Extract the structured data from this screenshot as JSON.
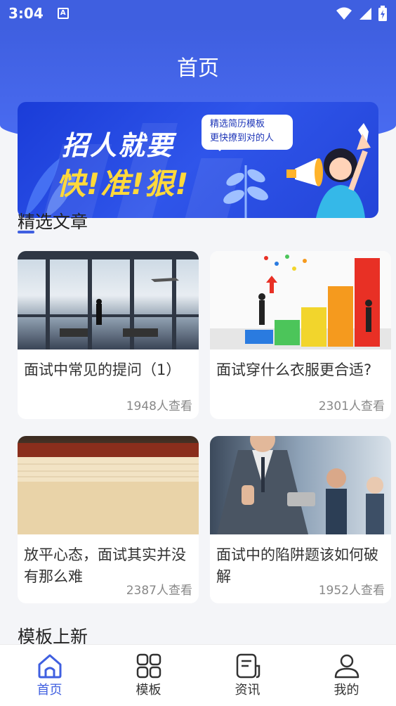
{
  "status_bar": {
    "time": "3:04",
    "notification_icon": "A",
    "icons": [
      "wifi-icon",
      "signal-icon",
      "battery-icon"
    ]
  },
  "header": {
    "title": "首页"
  },
  "banner": {
    "line1": "招人就要",
    "line2": "快!准!狠!",
    "bubble_line1": "精选简历模板",
    "bubble_line2": "更快撩到对的人"
  },
  "sections": {
    "articles_title": "精选文章",
    "templates_title": "模板上新"
  },
  "articles": [
    {
      "title": "面试中常见的提问（1）",
      "views": "1948人查看"
    },
    {
      "title": "面试穿什么衣服更合适?",
      "views": "2301人查看"
    },
    {
      "title": "放平心态，面试其实并没有那么难",
      "views": "2387人查看"
    },
    {
      "title": "面试中的陷阱题该如何破解",
      "views": "1952人查看"
    }
  ],
  "tabbar": {
    "items": [
      {
        "label": "首页",
        "icon": "home-icon",
        "active": true
      },
      {
        "label": "模板",
        "icon": "grid-icon",
        "active": false
      },
      {
        "label": "资讯",
        "icon": "news-icon",
        "active": false
      },
      {
        "label": "我的",
        "icon": "user-icon",
        "active": false
      }
    ]
  },
  "colors": {
    "primary": "#3f5fe0",
    "banner_accent": "#ffd93b"
  }
}
